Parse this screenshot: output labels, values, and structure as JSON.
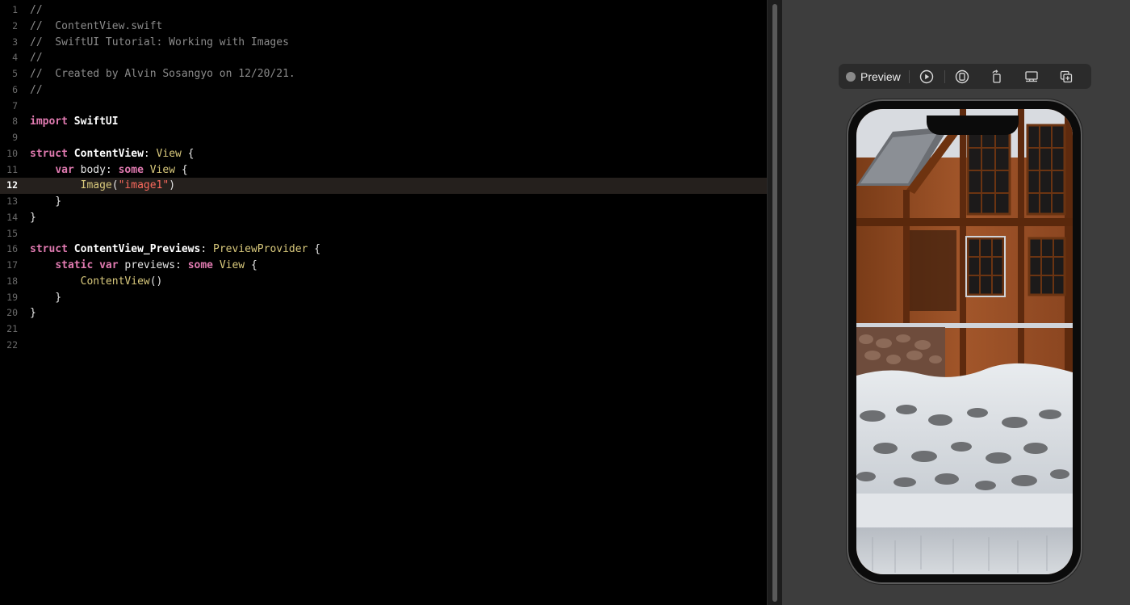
{
  "editor": {
    "current_line": 12,
    "lines": [
      {
        "number": "1",
        "tokens": [
          {
            "t": "//",
            "c": "comment"
          }
        ]
      },
      {
        "number": "2",
        "tokens": [
          {
            "t": "//  ContentView.swift",
            "c": "comment"
          }
        ]
      },
      {
        "number": "3",
        "tokens": [
          {
            "t": "//  SwiftUI Tutorial: Working with Images",
            "c": "comment"
          }
        ]
      },
      {
        "number": "4",
        "tokens": [
          {
            "t": "//",
            "c": "comment"
          }
        ]
      },
      {
        "number": "5",
        "tokens": [
          {
            "t": "//  Created by Alvin Sosangyo on 12/20/21.",
            "c": "comment"
          }
        ]
      },
      {
        "number": "6",
        "tokens": [
          {
            "t": "//",
            "c": "comment"
          }
        ]
      },
      {
        "number": "7",
        "tokens": []
      },
      {
        "number": "8",
        "tokens": [
          {
            "t": "import",
            "c": "keyword"
          },
          {
            "t": " ",
            "c": "plain"
          },
          {
            "t": "SwiftUI",
            "c": "type-bold"
          }
        ]
      },
      {
        "number": "9",
        "tokens": []
      },
      {
        "number": "10",
        "tokens": [
          {
            "t": "struct",
            "c": "keyword"
          },
          {
            "t": " ",
            "c": "plain"
          },
          {
            "t": "ContentView",
            "c": "type-bold"
          },
          {
            "t": ": ",
            "c": "plain"
          },
          {
            "t": "View",
            "c": "type"
          },
          {
            "t": " {",
            "c": "plain"
          }
        ]
      },
      {
        "number": "11",
        "tokens": [
          {
            "t": "    ",
            "c": "plain"
          },
          {
            "t": "var",
            "c": "keyword"
          },
          {
            "t": " body: ",
            "c": "plain"
          },
          {
            "t": "some",
            "c": "keyword"
          },
          {
            "t": " ",
            "c": "plain"
          },
          {
            "t": "View",
            "c": "type"
          },
          {
            "t": " {",
            "c": "plain"
          }
        ]
      },
      {
        "number": "12",
        "tokens": [
          {
            "t": "        ",
            "c": "plain"
          },
          {
            "t": "Image",
            "c": "type"
          },
          {
            "t": "(",
            "c": "plain"
          },
          {
            "t": "\"image1\"",
            "c": "string"
          },
          {
            "t": ")",
            "c": "plain"
          }
        ]
      },
      {
        "number": "13",
        "tokens": [
          {
            "t": "    }",
            "c": "plain"
          }
        ]
      },
      {
        "number": "14",
        "tokens": [
          {
            "t": "}",
            "c": "plain"
          }
        ]
      },
      {
        "number": "15",
        "tokens": []
      },
      {
        "number": "16",
        "tokens": [
          {
            "t": "struct",
            "c": "keyword"
          },
          {
            "t": " ",
            "c": "plain"
          },
          {
            "t": "ContentView_Previews",
            "c": "type-bold"
          },
          {
            "t": ": ",
            "c": "plain"
          },
          {
            "t": "PreviewProvider",
            "c": "type"
          },
          {
            "t": " {",
            "c": "plain"
          }
        ]
      },
      {
        "number": "17",
        "tokens": [
          {
            "t": "    ",
            "c": "plain"
          },
          {
            "t": "static",
            "c": "keyword"
          },
          {
            "t": " ",
            "c": "plain"
          },
          {
            "t": "var",
            "c": "keyword"
          },
          {
            "t": " previews: ",
            "c": "plain"
          },
          {
            "t": "some",
            "c": "keyword"
          },
          {
            "t": " ",
            "c": "plain"
          },
          {
            "t": "View",
            "c": "type"
          },
          {
            "t": " {",
            "c": "plain"
          }
        ]
      },
      {
        "number": "18",
        "tokens": [
          {
            "t": "        ",
            "c": "plain"
          },
          {
            "t": "ContentView",
            "c": "type"
          },
          {
            "t": "()",
            "c": "plain"
          }
        ]
      },
      {
        "number": "19",
        "tokens": [
          {
            "t": "    }",
            "c": "plain"
          }
        ]
      },
      {
        "number": "20",
        "tokens": [
          {
            "t": "}",
            "c": "plain"
          }
        ]
      },
      {
        "number": "21",
        "tokens": []
      },
      {
        "number": "22",
        "tokens": []
      }
    ]
  },
  "canvas": {
    "preview_label": "Preview",
    "toolbar_icons": [
      "live-preview-icon",
      "variants-icon",
      "rotate-device-icon",
      "device-settings-icon",
      "duplicate-preview-icon"
    ],
    "device_content": "snowy-wooden-house-photo"
  },
  "colors": {
    "editor_background": "#000000",
    "canvas_background": "#3d3d3d",
    "keyword": "#e07ab0",
    "string": "#fc6a5d",
    "comment": "#8b8b8b",
    "type": "#d9c97c"
  }
}
